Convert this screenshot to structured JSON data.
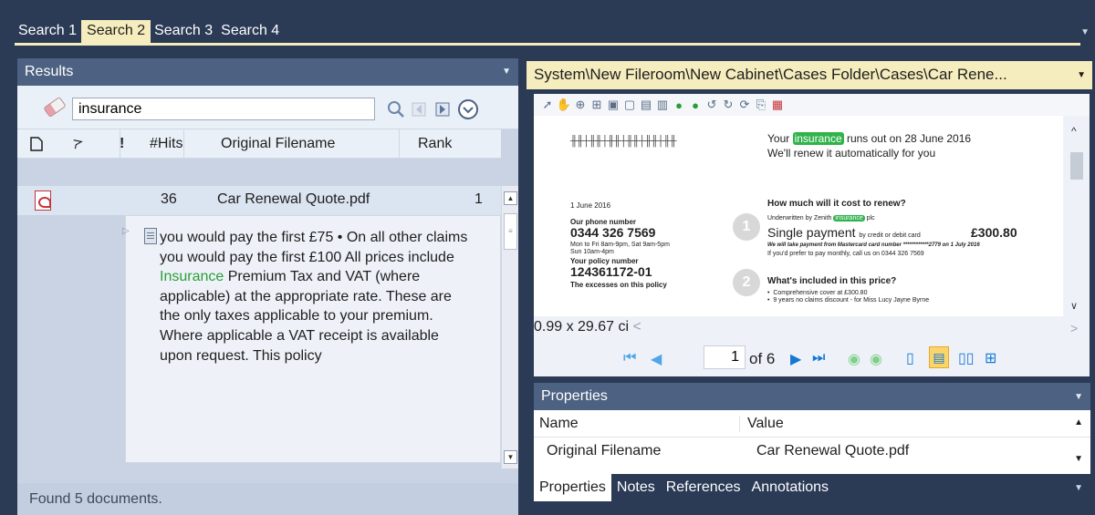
{
  "tabs": [
    "Search 1",
    "Search 2",
    "Search 3",
    "Search 4"
  ],
  "active_tab": 1,
  "results": {
    "title": "Results",
    "search_value": "insurance",
    "columns": [
      "#Hits",
      "Original Filename",
      "Rank"
    ],
    "row": {
      "hits": "36",
      "filename": "Car Renewal Quote.pdf",
      "rank": "1"
    },
    "snippet_before": "you would pay the first £75 • On all other claims you would pay the first £100 All prices include ",
    "snippet_highlight": "Insurance",
    "snippet_after": " Premium Tax and VAT (where applicable) at the appropriate rate. These are the only taxes applicable to your premium. Where applicable a VAT receipt is available upon request. This policy",
    "status": "Found 5 documents."
  },
  "viewer": {
    "path": "System\\New Fileroom\\New Cabinet\\Cases Folder\\Cases\\Car Rene...",
    "coords": "0.99 x 29.67 ci",
    "page_current": "1",
    "page_of": "of 6",
    "doc": {
      "top_line_1_pre": "Your ",
      "top_line_1_hl": "insurance",
      "top_line_1_post": " runs out on 28 June 2016",
      "top_line_2": "We'll renew it automatically for you",
      "date": "1 June 2016",
      "phone_label": "Our phone number",
      "phone": "0344 326 7569",
      "hours_1": "Mon to Fri 8am-9pm, Sat 9am-5pm",
      "hours_2": "Sun 10am-4pm",
      "policy_label": "Your policy number",
      "policy": "124361172-01",
      "excess_label": "The excesses on this policy",
      "cost_heading": "How much will it cost to renew?",
      "underwritten_pre": "Underwritten by Zenith ",
      "underwritten_hl": "insurance",
      "underwritten_post": " plc",
      "single_payment": "Single payment",
      "single_payment_small": "by credit or debit card",
      "amount": "£300.80",
      "payment_note": "We will take payment from Mastercard card number ************2779 on 1 July 2016",
      "monthly_note": "If you'd prefer to pay monthly, call us on 0344 326 7569",
      "included_heading": "What's included in this price?",
      "bullet_1": "Comprehensive cover at £300.80",
      "bullet_2": "9 years no claims discount - for Miss Lucy Jayne Byrne",
      "step_1": "1",
      "step_2": "2"
    }
  },
  "properties": {
    "title": "Properties",
    "col_name": "Name",
    "col_value": "Value",
    "row_name": "Original Filename",
    "row_value": "Car Renewal Quote.pdf"
  },
  "bottom_tabs": [
    "Properties",
    "Notes",
    "References",
    "Annotations"
  ]
}
